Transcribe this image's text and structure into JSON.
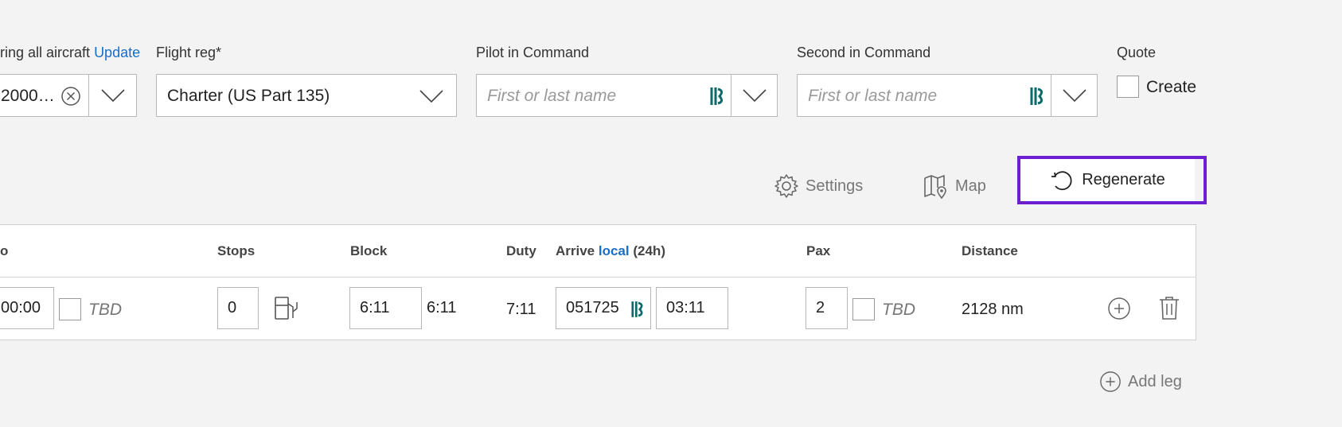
{
  "top": {
    "aircraft_label": "ring all aircraft",
    "aircraft_update_link": "Update",
    "aircraft_value": "2000…",
    "flight_reg_label": "Flight reg*",
    "flight_reg_value": "Charter (US Part 135)",
    "pic_label": "Pilot in Command",
    "pic_placeholder": "First or last name",
    "sic_label": "Second in Command",
    "sic_placeholder": "First or last name",
    "quote_label": "Quote",
    "quote_create": "Create"
  },
  "toolbar": {
    "settings_label": "Settings",
    "map_label": "Map",
    "regenerate_label": "Regenerate"
  },
  "table": {
    "headers": {
      "stops": "Stops",
      "block": "Block",
      "duty": "Duty",
      "arrive": "Arrive",
      "arrive_local": "local",
      "arrive_24h": "(24h)",
      "pax": "Pax",
      "distance": "Distance",
      "partial_link": "o"
    },
    "row": {
      "depart_time": "00:00",
      "depart_tbd": "TBD",
      "stops": "0",
      "block_input": "6:11",
      "block_value": "6:11",
      "duty": "7:11",
      "arrive_date": "051725",
      "arrive_time": "03:11",
      "pax": "2",
      "pax_tbd": "TBD",
      "distance": "2128 nm"
    }
  },
  "add_leg_label": "Add leg",
  "colors": {
    "accent_blue": "#1a6ec5",
    "highlight_purple": "#6b1fd1",
    "teal_icon": "#0c6a6a"
  }
}
